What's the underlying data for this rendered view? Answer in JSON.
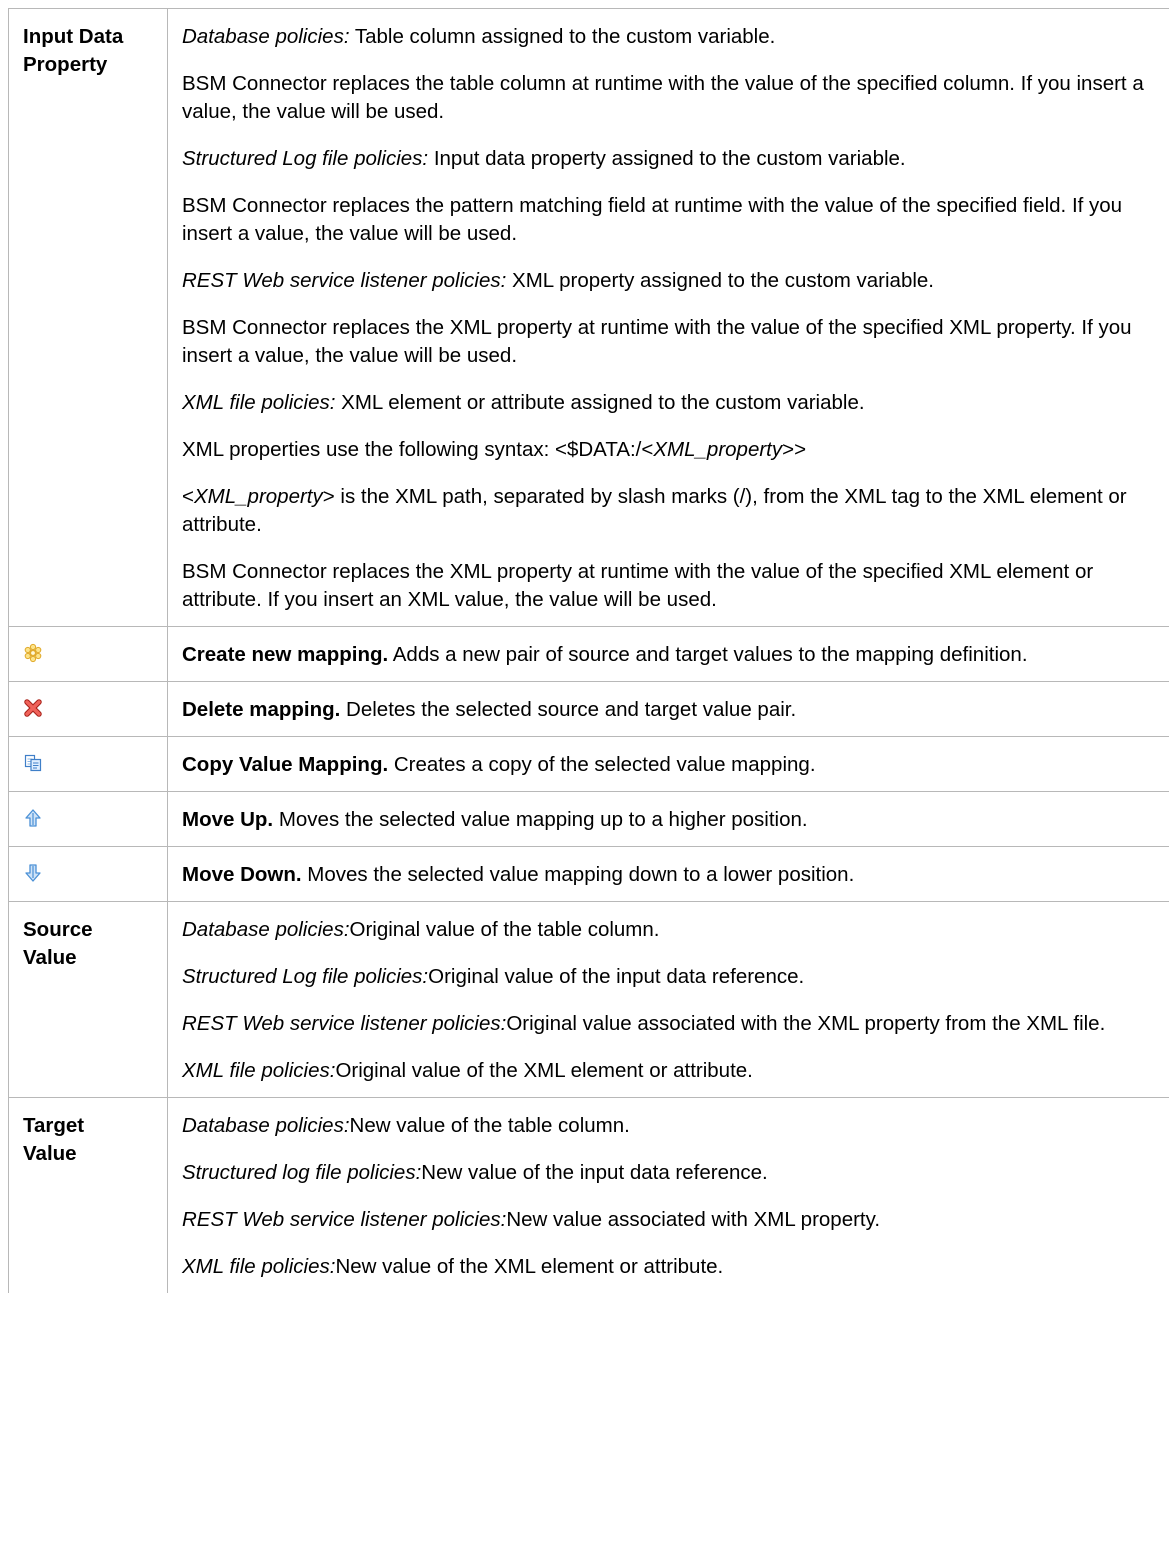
{
  "rows": {
    "input_data_property": {
      "label": "Input Data Property",
      "paragraphs": [
        {
          "lead": "Database policies:",
          "text": " Table column assigned to the custom variable."
        },
        {
          "lead": "",
          "text": "BSM Connector replaces the table column at runtime with the value of the specified column. If you insert a value, the value will be used."
        },
        {
          "lead": "Structured Log file policies:",
          "text": " Input data property assigned to the custom variable."
        },
        {
          "lead": "",
          "text": "BSM Connector replaces the pattern matching field at runtime with the value of the specified field. If you insert a value, the value will be used."
        },
        {
          "lead": "REST Web service listener policies:",
          "text": " XML property assigned to the custom variable."
        },
        {
          "lead": "",
          "text": "BSM Connector replaces the XML property at runtime with the value of the specified XML property. If you insert a value, the value will be used."
        },
        {
          "lead": "XML file policies:",
          "text": " XML element or attribute assigned to the custom variable."
        }
      ],
      "syntax": {
        "prefix": "XML properties use the following syntax: <$DATA:/<",
        "italic": "XML_property",
        "suffix": ">>"
      },
      "path_note": {
        "prefix": "<",
        "italic": "XML_property",
        "suffix": "> is the XML path, separated by slash marks (/), from the XML tag to the XML element or attribute."
      },
      "final": "BSM Connector replaces the XML property at runtime with the value of the specified XML element or attribute. If you insert an XML value, the value will be used."
    },
    "create_mapping": {
      "icon": "new-star-icon",
      "title": "Create new mapping.",
      "text": " Adds a new pair of source and target values to the mapping definition."
    },
    "delete_mapping": {
      "icon": "delete-x-icon",
      "title": "Delete mapping.",
      "text": " Deletes the selected source and target value pair."
    },
    "copy_mapping": {
      "icon": "copy-icon",
      "title": "Copy Value Mapping.",
      "text": " Creates a copy of the selected value mapping."
    },
    "move_up": {
      "icon": "arrow-up-icon",
      "title": "Move Up.",
      "text": " Moves the selected value mapping up to a higher position."
    },
    "move_down": {
      "icon": "arrow-down-icon",
      "title": "Move Down.",
      "text": " Moves the selected value mapping down to a lower position."
    },
    "source_value": {
      "label": "Source Value",
      "paragraphs": [
        {
          "lead": "Database policies:",
          "text": "Original value of the table column."
        },
        {
          "lead": "Structured Log file policies:",
          "text": "Original value of the input data reference."
        },
        {
          "lead": "REST Web service listener policies:",
          "text": "Original value associated with the XML property from the XML file."
        },
        {
          "lead": "XML file policies:",
          "text": "Original value of the XML element or attribute."
        }
      ]
    },
    "target_value": {
      "label": "Target Value",
      "paragraphs": [
        {
          "lead": "Database policies:",
          "text": "New value of the table column."
        },
        {
          "lead": "Structured log file policies:",
          "text": "New value of the input data reference."
        },
        {
          "lead": "REST Web service listener policies:",
          "text": "New value associated with XML property."
        },
        {
          "lead": "XML file policies:",
          "text": "New value of the XML element or attribute."
        }
      ]
    }
  },
  "colors": {
    "border": "#b8b8b8",
    "new_icon": "#f2c94c",
    "delete_icon": "#e0453a",
    "copy_icon": "#3f8fd9",
    "arrow_icon": "#4a90d6"
  }
}
